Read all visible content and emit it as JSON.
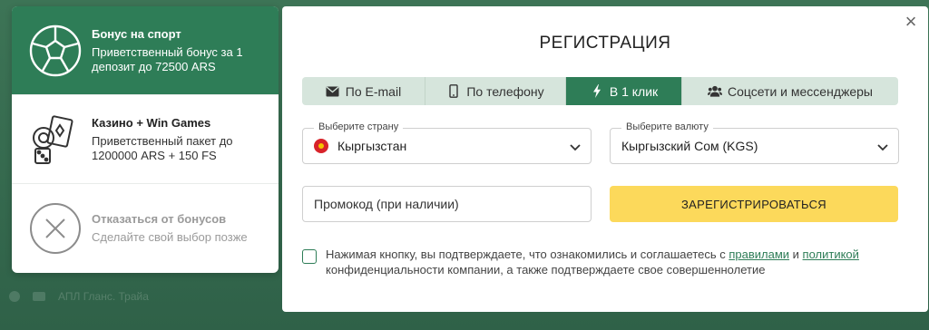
{
  "background": {
    "dimmed_row_text": "АПЛ Гланс. Трайа"
  },
  "bonuses": [
    {
      "title": "Бонус на спорт",
      "description": "Приветственный бонус за 1 депозит до 72500 ARS",
      "icon": "soccer-ball-icon",
      "state": "selected"
    },
    {
      "title": "Казино + Win Games",
      "description": "Приветственный пакет до 1200000 ARS + 150 FS",
      "icon": "casino-icon",
      "state": "available"
    },
    {
      "title": "Отказаться от бонусов",
      "description": "Сделайте свой выбор позже",
      "icon": "decline-icon",
      "state": "available"
    }
  ],
  "modal": {
    "title": "РЕГИСТРАЦИЯ",
    "close_label": "×",
    "tabs": [
      {
        "label": "По E-mail",
        "icon": "envelope-icon",
        "active": false
      },
      {
        "label": "По телефону",
        "icon": "phone-icon",
        "active": false
      },
      {
        "label": "В 1 клик",
        "icon": "lightning-icon",
        "active": true
      },
      {
        "label": "Соцсети и мессенджеры",
        "icon": "users-icon",
        "active": false
      }
    ],
    "country": {
      "label": "Выберите страну",
      "value": "Кыргызстан"
    },
    "currency": {
      "label": "Выберите валюту",
      "value": "Кыргызский Сом (KGS)"
    },
    "promo": {
      "placeholder": "Промокод (при наличии)"
    },
    "register_label": "ЗАРЕГИСТРИРОВАТЬСЯ",
    "agreement": {
      "text_before": "Нажимая кнопку, вы подтверждаете, что ознакомились и соглашаетесь с ",
      "link1": "правилами",
      "text_middle": " и ",
      "link2": "политикой",
      "text_after": " конфиденциальности компании, а также подтверждаете свое совершеннолетие"
    }
  },
  "colors": {
    "accent": "#2e7d57",
    "button": "#fcd95b",
    "tabs_bg": "#d6e5dc"
  }
}
